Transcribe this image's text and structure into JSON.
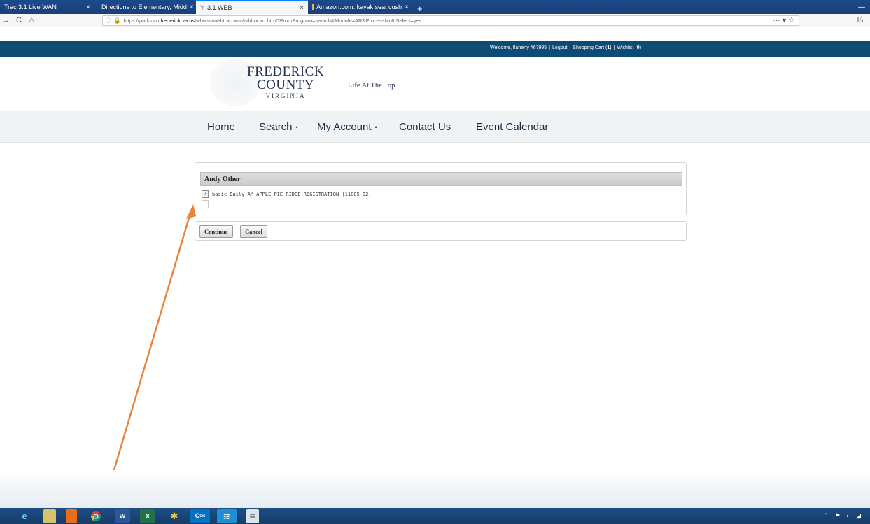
{
  "browser": {
    "tabs": [
      {
        "label": "Trac 3.1 Live WAN",
        "close": "×",
        "active": false
      },
      {
        "label": "Directions to Elementary, Midd",
        "close": "×",
        "active": false
      },
      {
        "label": "3.1 WEB",
        "close": "×",
        "active": true
      },
      {
        "label": "Amazon.com: kayak seat cush",
        "close": "×",
        "active": false
      }
    ],
    "new_tab": "+",
    "url_prefix": "https://parks.co.",
    "url_host": "frederick.va.us",
    "url_path": "/wbwsc/webtrac.wsc/addtocart.html?FromProgram=search&Module=AR&ProcessMultiSelect=yes",
    "url_actions": "··· ♥ ☆",
    "nav_back": "→",
    "nav_reload": "C",
    "nav_home": "⌂",
    "library": "II\\"
  },
  "site": {
    "welcome": {
      "text": "Welcome, flaherty #67995",
      "logout": "Logout",
      "cart_label": "Shopping Cart (",
      "cart_count": "1",
      "wishlist_label": "Wishlist (",
      "wishlist_count": "0"
    },
    "logo": {
      "line1": "FREDERICK",
      "line2": "COUNTY",
      "line3": "VIRGINIA",
      "tagline": "Life At The Top"
    },
    "nav": [
      {
        "label": "Home",
        "has_menu": false
      },
      {
        "label": "Search",
        "has_menu": true
      },
      {
        "label": "My Account",
        "has_menu": true
      },
      {
        "label": "Contact Us",
        "has_menu": false
      },
      {
        "label": "Event Calendar",
        "has_menu": false
      }
    ]
  },
  "selection": {
    "person": "Andy Other",
    "item": {
      "label": "basic Daily AM APPLE PIE RIDGE-REGISTRATION (11805-02)",
      "checked": true,
      "check_glyph": "✓"
    }
  },
  "actions": {
    "continue": "Continue",
    "cancel": "Cancel"
  },
  "colors": {
    "site_header": "#0d4a74",
    "annotation_arrow": "#e8843c",
    "taskbar": "#1e4d84"
  },
  "taskbar": {
    "icons": [
      "ie-icon",
      "file-explorer-icon",
      "media-player-icon",
      "chrome-icon",
      "word-icon",
      "excel-icon",
      "app-icon",
      "outlook-icon",
      "network-icon",
      "notepad-icon"
    ]
  }
}
